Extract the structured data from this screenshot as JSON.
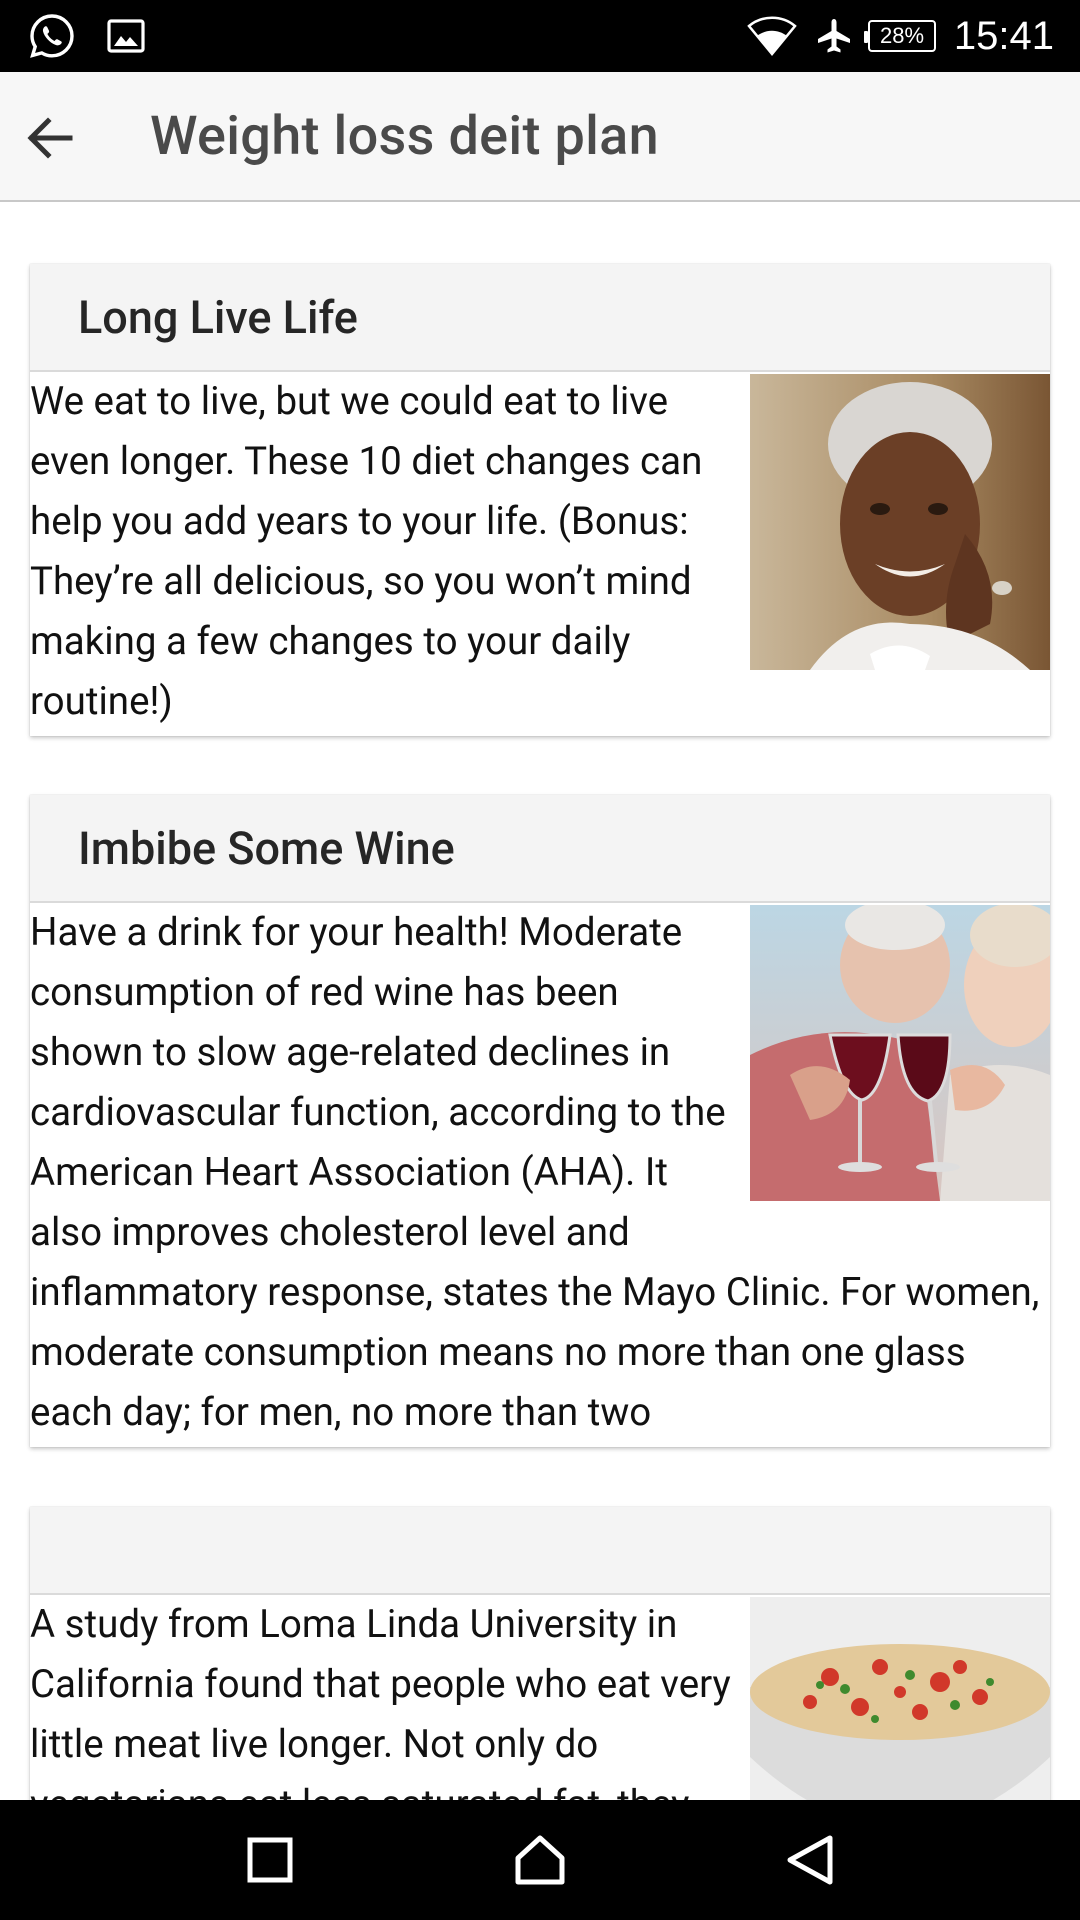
{
  "status_bar": {
    "time": "15:41",
    "battery": "28%",
    "icons": [
      "whatsapp-icon",
      "gallery-icon",
      "wifi-icon",
      "airplane-mode-icon",
      "battery-icon"
    ]
  },
  "app_bar": {
    "title": "Weight loss deit plan",
    "back_icon": "arrow-back-icon"
  },
  "cards": [
    {
      "title": "Long Live Life",
      "body": "We eat to live, but we could eat to live even longer. These 10 diet changes can help you add years to your life. (Bonus: They’re all delicious, so you won’t mind making a few changes to your daily routine!)",
      "image": "smiling-elderly-woman-photo"
    },
    {
      "title": "Imbibe Some Wine",
      "body": "Have a drink for your health! Moderate consumption of red wine has been shown to slow age-related declines in cardiovascular function, according to the American Heart Association (AHA). It also improves cholesterol level and inflammatory response, states the Mayo Clinic. For women, moderate consumption means no more than one glass each day; for men, no more than two",
      "image": "elderly-couple-wine-toast-photo"
    },
    {
      "title": "",
      "body": "A study from Loma Linda University in California found that people who eat very little meat live longer. Not only do vegetarians eat less saturated fat, they",
      "image": "grain-salad-bowl-photo"
    }
  ],
  "nav_bar": {
    "icons": [
      "recents-square-icon",
      "home-icon",
      "back-triangle-icon"
    ]
  }
}
